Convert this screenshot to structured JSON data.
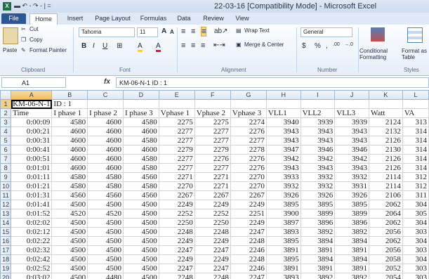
{
  "window": {
    "title": "22-03-16  [Compatibility Mode]  -  Microsoft Excel",
    "app_icon": "X",
    "qat": "▬ ↶ - ↷ - | ="
  },
  "tabs": [
    "File",
    "Home",
    "Insert",
    "Page Layout",
    "Formulas",
    "Data",
    "Review",
    "View"
  ],
  "ribbon": {
    "clipboard": {
      "paste": "Paste",
      "cut": "Cut",
      "copy": "Copy",
      "format_painter": "Format Painter",
      "label": "Clipboard"
    },
    "font": {
      "name": "Tahoma",
      "size": "11",
      "label": "Font",
      "grow": "A",
      "shrink": "A",
      "bold": "B",
      "italic": "I",
      "underline": "U",
      "borders": "⊞",
      "fill": "A",
      "color": "A"
    },
    "alignment": {
      "wrap": "Wrap Text",
      "merge": "Merge & Center",
      "label": "Alignment"
    },
    "number": {
      "format": "General",
      "currency": "$",
      "percent": "%",
      "comma": ",",
      "inc": ".00",
      "dec": "→.0",
      "label": "Number"
    },
    "styles": {
      "conditional": "Conditional Formatting",
      "format_as": "Format as Table",
      "label": "Styles"
    }
  },
  "formula_bar": {
    "name_box": "A1",
    "fx": "fx",
    "content": "KM-06-N-1 ID : 1"
  },
  "columns": [
    "A",
    "B",
    "C",
    "D",
    "E",
    "F",
    "G",
    "H",
    "I",
    "J",
    "K",
    "L"
  ],
  "rows": [
    [
      "KM-06-N-1",
      "ID : 1",
      "",
      "",
      "",
      "",
      "",
      "",
      "",
      "",
      "",
      ""
    ],
    [
      "Time",
      "I phase 1",
      "I phase 2",
      "I phase 3",
      "Vphase 1",
      "Vphase 2",
      "Vphase 3",
      "VLL1",
      "VLL2",
      "VLL3",
      "Watt",
      "VA"
    ],
    [
      "0:00:09",
      "4580",
      "4600",
      "4580",
      "2275",
      "2275",
      "2274",
      "3940",
      "3939",
      "3939",
      "2124",
      "313"
    ],
    [
      "0:00:21",
      "4600",
      "4600",
      "4600",
      "2277",
      "2277",
      "2276",
      "3943",
      "3943",
      "3943",
      "2132",
      "314"
    ],
    [
      "0:00:31",
      "4600",
      "4600",
      "4580",
      "2277",
      "2277",
      "2277",
      "3943",
      "3943",
      "3943",
      "2126",
      "314"
    ],
    [
      "0:00:41",
      "4600",
      "4600",
      "4600",
      "2279",
      "2279",
      "2278",
      "3947",
      "3946",
      "3946",
      "2130",
      "314"
    ],
    [
      "0:00:51",
      "4600",
      "4600",
      "4580",
      "2277",
      "2276",
      "2276",
      "3942",
      "3942",
      "3942",
      "2126",
      "314"
    ],
    [
      "0:01:01",
      "4600",
      "4600",
      "4580",
      "2277",
      "2277",
      "2276",
      "3943",
      "3943",
      "3943",
      "2126",
      "314"
    ],
    [
      "0:01:11",
      "4580",
      "4580",
      "4560",
      "2271",
      "2271",
      "2270",
      "3933",
      "3932",
      "3932",
      "2114",
      "312"
    ],
    [
      "0:01:21",
      "4580",
      "4580",
      "4580",
      "2270",
      "2271",
      "2270",
      "3932",
      "3932",
      "3931",
      "2114",
      "312"
    ],
    [
      "0:01:31",
      "4560",
      "4560",
      "4560",
      "2267",
      "2267",
      "2267",
      "3926",
      "3926",
      "3926",
      "2106",
      "311"
    ],
    [
      "0:01:41",
      "4500",
      "4500",
      "4500",
      "2249",
      "2249",
      "2249",
      "3895",
      "3895",
      "3895",
      "2062",
      "304"
    ],
    [
      "0:01:52",
      "4520",
      "4520",
      "4500",
      "2252",
      "2252",
      "2251",
      "3900",
      "3899",
      "3899",
      "2064",
      "305"
    ],
    [
      "0:02:02",
      "4500",
      "4500",
      "4500",
      "2250",
      "2250",
      "2249",
      "3897",
      "3896",
      "3896",
      "2062",
      "304"
    ],
    [
      "0:02:12",
      "4500",
      "4500",
      "4500",
      "2248",
      "2248",
      "2247",
      "3893",
      "3892",
      "3892",
      "2056",
      "303"
    ],
    [
      "0:02:22",
      "4500",
      "4500",
      "4500",
      "2249",
      "2249",
      "2248",
      "3895",
      "3894",
      "3894",
      "2062",
      "304"
    ],
    [
      "0:02:32",
      "4500",
      "4500",
      "4500",
      "2247",
      "2247",
      "2246",
      "3891",
      "3891",
      "3891",
      "2056",
      "303"
    ],
    [
      "0:02:42",
      "4500",
      "4500",
      "4500",
      "2249",
      "2249",
      "2248",
      "3895",
      "3894",
      "3894",
      "2058",
      "304"
    ],
    [
      "0:02:52",
      "4500",
      "4500",
      "4500",
      "2247",
      "2247",
      "2246",
      "3891",
      "3891",
      "3891",
      "2052",
      "303"
    ],
    [
      "0:03:02",
      "4500",
      "4480",
      "4500",
      "2248",
      "2248",
      "2247",
      "3893",
      "3892",
      "3892",
      "2054",
      "303"
    ]
  ]
}
